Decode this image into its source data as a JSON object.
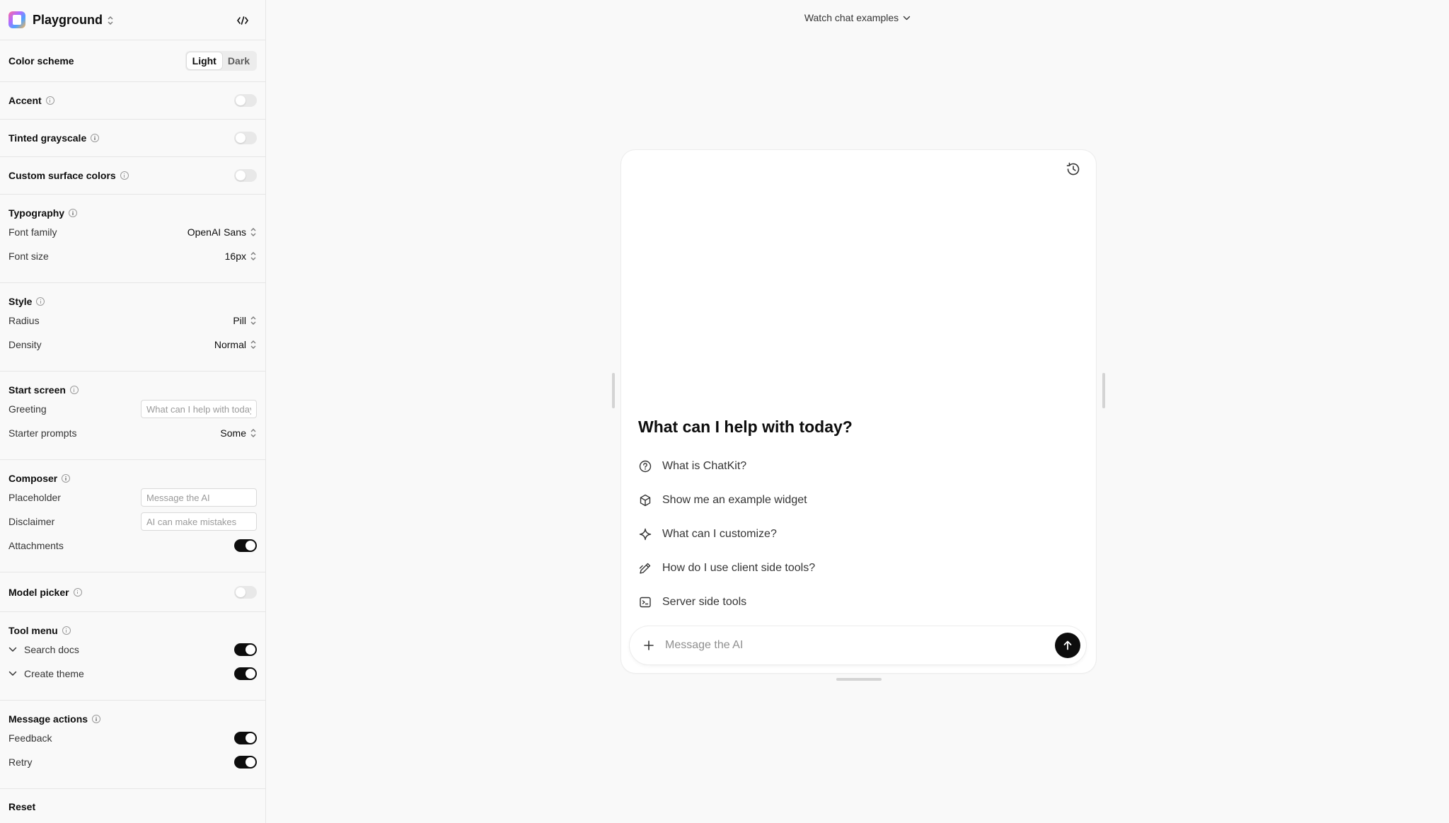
{
  "sidebar": {
    "title": "Playground",
    "color_scheme": {
      "label": "Color scheme",
      "options": [
        "Light",
        "Dark"
      ],
      "selected": "Light"
    },
    "accent": {
      "label": "Accent",
      "on": false
    },
    "tinted_grayscale": {
      "label": "Tinted grayscale",
      "on": false
    },
    "custom_surface": {
      "label": "Custom surface colors",
      "on": false
    },
    "typography": {
      "label": "Typography",
      "font_family": {
        "label": "Font family",
        "value": "OpenAI Sans"
      },
      "font_size": {
        "label": "Font size",
        "value": "16px"
      }
    },
    "style": {
      "label": "Style",
      "radius": {
        "label": "Radius",
        "value": "Pill"
      },
      "density": {
        "label": "Density",
        "value": "Normal"
      }
    },
    "start_screen": {
      "label": "Start screen",
      "greeting": {
        "label": "Greeting",
        "placeholder": "What can I help with today?"
      },
      "starter_prompts": {
        "label": "Starter prompts",
        "value": "Some"
      }
    },
    "composer": {
      "label": "Composer",
      "placeholder": {
        "label": "Placeholder",
        "placeholder": "Message the AI"
      },
      "disclaimer": {
        "label": "Disclaimer",
        "placeholder": "AI can make mistakes"
      },
      "attachments": {
        "label": "Attachments",
        "on": true
      }
    },
    "model_picker": {
      "label": "Model picker",
      "on": false
    },
    "tool_menu": {
      "label": "Tool menu",
      "search_docs": {
        "label": "Search docs",
        "on": true
      },
      "create_theme": {
        "label": "Create theme",
        "on": true
      }
    },
    "message_actions": {
      "label": "Message actions",
      "feedback": {
        "label": "Feedback",
        "on": true
      },
      "retry": {
        "label": "Retry",
        "on": true
      }
    },
    "reset_label": "Reset"
  },
  "main": {
    "watch_label": "Watch chat examples",
    "greeting": "What can I help with today?",
    "prompts": [
      {
        "label": "What is ChatKit?",
        "icon": "question-circle-icon"
      },
      {
        "label": "Show me an example widget",
        "icon": "cube-icon"
      },
      {
        "label": "What can I customize?",
        "icon": "sparkle-icon"
      },
      {
        "label": "How do I use client side tools?",
        "icon": "pencil-icon"
      },
      {
        "label": "Server side tools",
        "icon": "terminal-icon"
      }
    ],
    "composer_placeholder": "Message the AI"
  },
  "colors": {
    "toggle_on": "#0d0d0d",
    "toggle_off": "#e8e8e8",
    "background": "#f9f9f9"
  }
}
